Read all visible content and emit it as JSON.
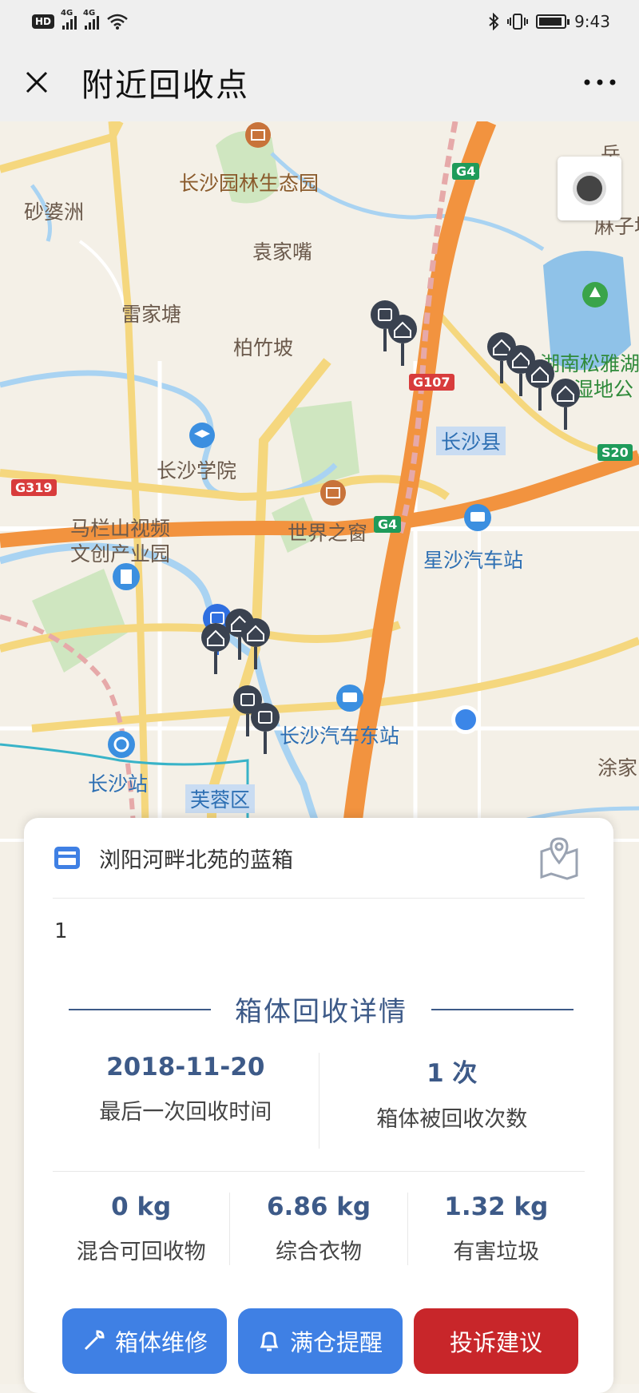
{
  "status_bar": {
    "hd": "HD",
    "network_1": "4G",
    "network_2": "4G",
    "time": "9:43"
  },
  "nav": {
    "title": "附近回收点"
  },
  "map": {
    "labels": [
      {
        "text": "长沙园林生态园",
        "kind": "park"
      },
      {
        "text": "砂婆洲",
        "kind": "place"
      },
      {
        "text": "袁家嘴",
        "kind": "place"
      },
      {
        "text": "雷家塘",
        "kind": "place"
      },
      {
        "text": "柏竹坡",
        "kind": "place"
      },
      {
        "text": "长沙学院",
        "kind": "place"
      },
      {
        "text": "马栏山视频",
        "kind": "place"
      },
      {
        "text": "文创产业园",
        "kind": "place"
      },
      {
        "text": "世界之窗",
        "kind": "place"
      },
      {
        "text": "星沙汽车站",
        "kind": "blue"
      },
      {
        "text": "长沙县",
        "kind": "blue"
      },
      {
        "text": "长沙汽车东站",
        "kind": "blue"
      },
      {
        "text": "长沙站",
        "kind": "blue"
      },
      {
        "text": "芙蓉区",
        "kind": "blue"
      },
      {
        "text": "湖南松雅湖",
        "kind": "green"
      },
      {
        "text": "湿地公",
        "kind": "green"
      },
      {
        "text": "麻子坡",
        "kind": "place"
      },
      {
        "text": "涂家",
        "kind": "place"
      },
      {
        "text": "岳",
        "kind": "place"
      }
    ],
    "road_badges": [
      {
        "text": "G4",
        "color": "#1f9b5a"
      },
      {
        "text": "G107",
        "color": "#d83c3c"
      },
      {
        "text": "G4",
        "color": "#1f9b5a"
      },
      {
        "text": "S20",
        "color": "#1f9b5a"
      },
      {
        "text": "G319",
        "color": "#d83c3c"
      }
    ],
    "my_location_color": "#3b86e8"
  },
  "detail_card": {
    "box_name": "浏阳河畔北苑的蓝箱",
    "description": "1",
    "section_title": "箱体回收详情",
    "last_recycle_date": "2018-11-20",
    "last_recycle_label": "最后一次回收时间",
    "recycle_count": "1 次",
    "recycle_count_label": "箱体被回收次数",
    "stats": [
      {
        "value": "0 kg",
        "label": "混合可回收物"
      },
      {
        "value": "6.86 kg",
        "label": "综合衣物"
      },
      {
        "value": "1.32 kg",
        "label": "有害垃圾"
      }
    ],
    "actions": [
      {
        "label": "箱体维修",
        "icon": "wrench-icon",
        "color": "#3f80e4"
      },
      {
        "label": "满仓提醒",
        "icon": "bell-icon",
        "color": "#3f80e4"
      },
      {
        "label": "投诉建议",
        "icon": "",
        "color": "#c8262a"
      }
    ]
  }
}
